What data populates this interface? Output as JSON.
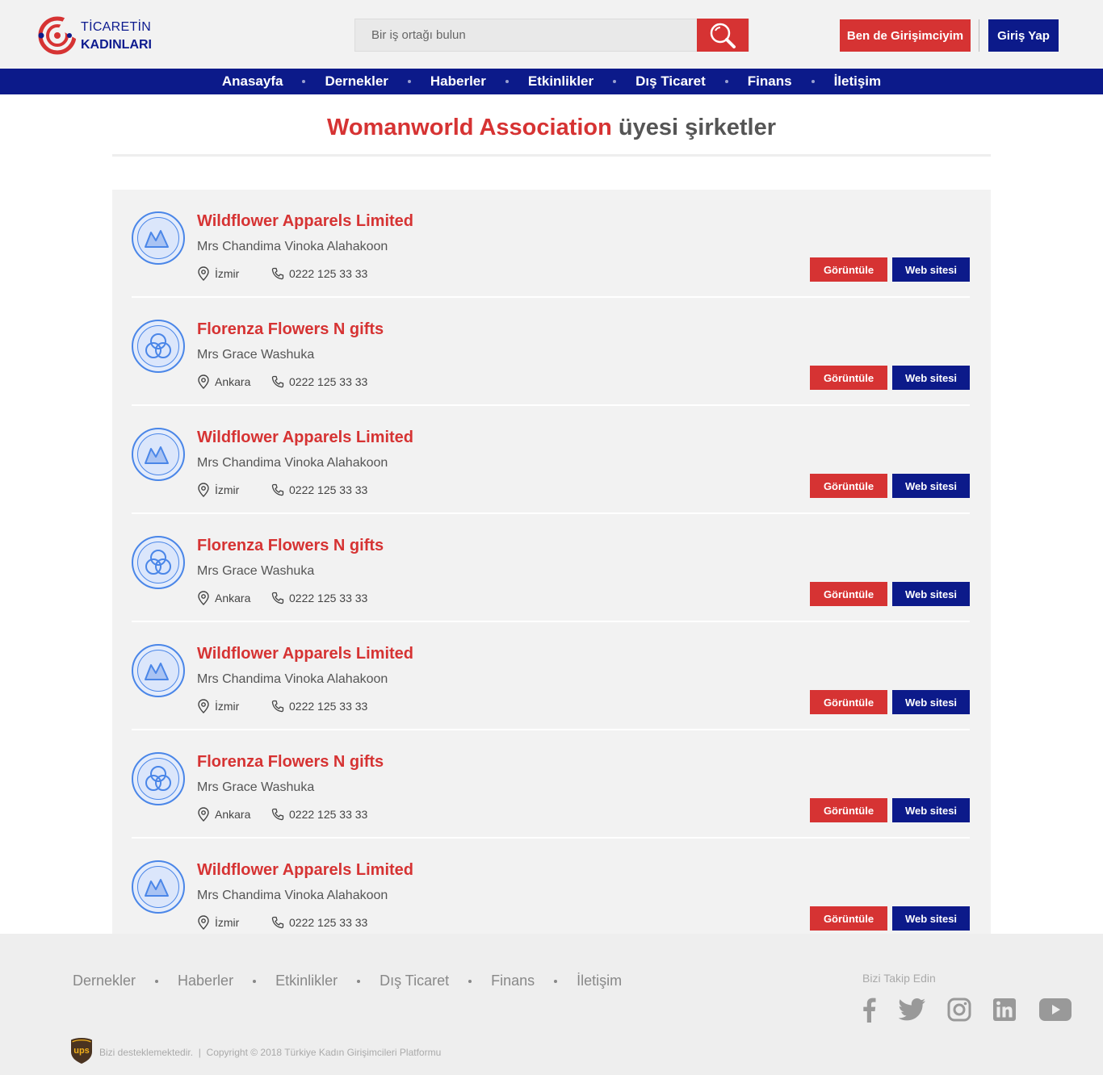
{
  "brand": {
    "line1": "TİCARETİN",
    "line2": "KADINLARI",
    "colors": {
      "red": "#d63333",
      "navy": "#0c1a8a"
    }
  },
  "search": {
    "placeholder": "Bir iş ortağı bulun",
    "icon": "search-icon"
  },
  "header": {
    "entrepreneur_label": "Ben de Girişimciyim",
    "login_label": "Giriş Yap"
  },
  "nav": [
    "Anasayfa",
    "Dernekler",
    "Haberler",
    "Etkinlikler",
    "Dış Ticaret",
    "Finans",
    "İletişim"
  ],
  "title": {
    "association": "Womanworld Association",
    "suffix": "üyesi şirketler"
  },
  "companies": [
    {
      "name": "Wildflower Apparels Limited",
      "person": "Mrs Chandima Vinoka Alahakoon",
      "city": "İzmir",
      "phone": "0222 125 33 33",
      "logo": "mountain-icon"
    },
    {
      "name": "Florenza Flowers N gifts",
      "person": "Mrs Grace Washuka",
      "city": "Ankara",
      "phone": "0222 125 33 33",
      "logo": "circles-icon"
    },
    {
      "name": "Wildflower Apparels Limited",
      "person": "Mrs Chandima Vinoka Alahakoon",
      "city": "İzmir",
      "phone": "0222 125 33 33",
      "logo": "mountain-icon"
    },
    {
      "name": "Florenza Flowers N gifts",
      "person": "Mrs Grace Washuka",
      "city": "Ankara",
      "phone": "0222 125 33 33",
      "logo": "circles-icon"
    },
    {
      "name": "Wildflower Apparels Limited",
      "person": "Mrs Chandima Vinoka Alahakoon",
      "city": "İzmir",
      "phone": "0222 125 33 33",
      "logo": "mountain-icon"
    },
    {
      "name": "Florenza Flowers N gifts",
      "person": "Mrs Grace Washuka",
      "city": "Ankara",
      "phone": "0222 125 33 33",
      "logo": "circles-icon"
    },
    {
      "name": "Wildflower Apparels Limited",
      "person": "Mrs Chandima Vinoka Alahakoon",
      "city": "İzmir",
      "phone": "0222 125 33 33",
      "logo": "mountain-icon"
    }
  ],
  "buttons": {
    "view_label": "Görüntüle",
    "web_label": "Web sitesi"
  },
  "footer": {
    "links": [
      "Dernekler",
      "Haberler",
      "Etkinlikler",
      "Dış Ticaret",
      "Finans",
      "İletişim"
    ],
    "follow_label": "Bizi Takip Edin",
    "social": [
      "facebook-icon",
      "twitter-icon",
      "instagram-icon",
      "linkedin-icon",
      "youtube-icon"
    ],
    "sponsor_text": "Bizi desteklemektedir.",
    "copyright": "Copyright © 2018 Türkiye Kadın Girişimcileri Platformu"
  }
}
